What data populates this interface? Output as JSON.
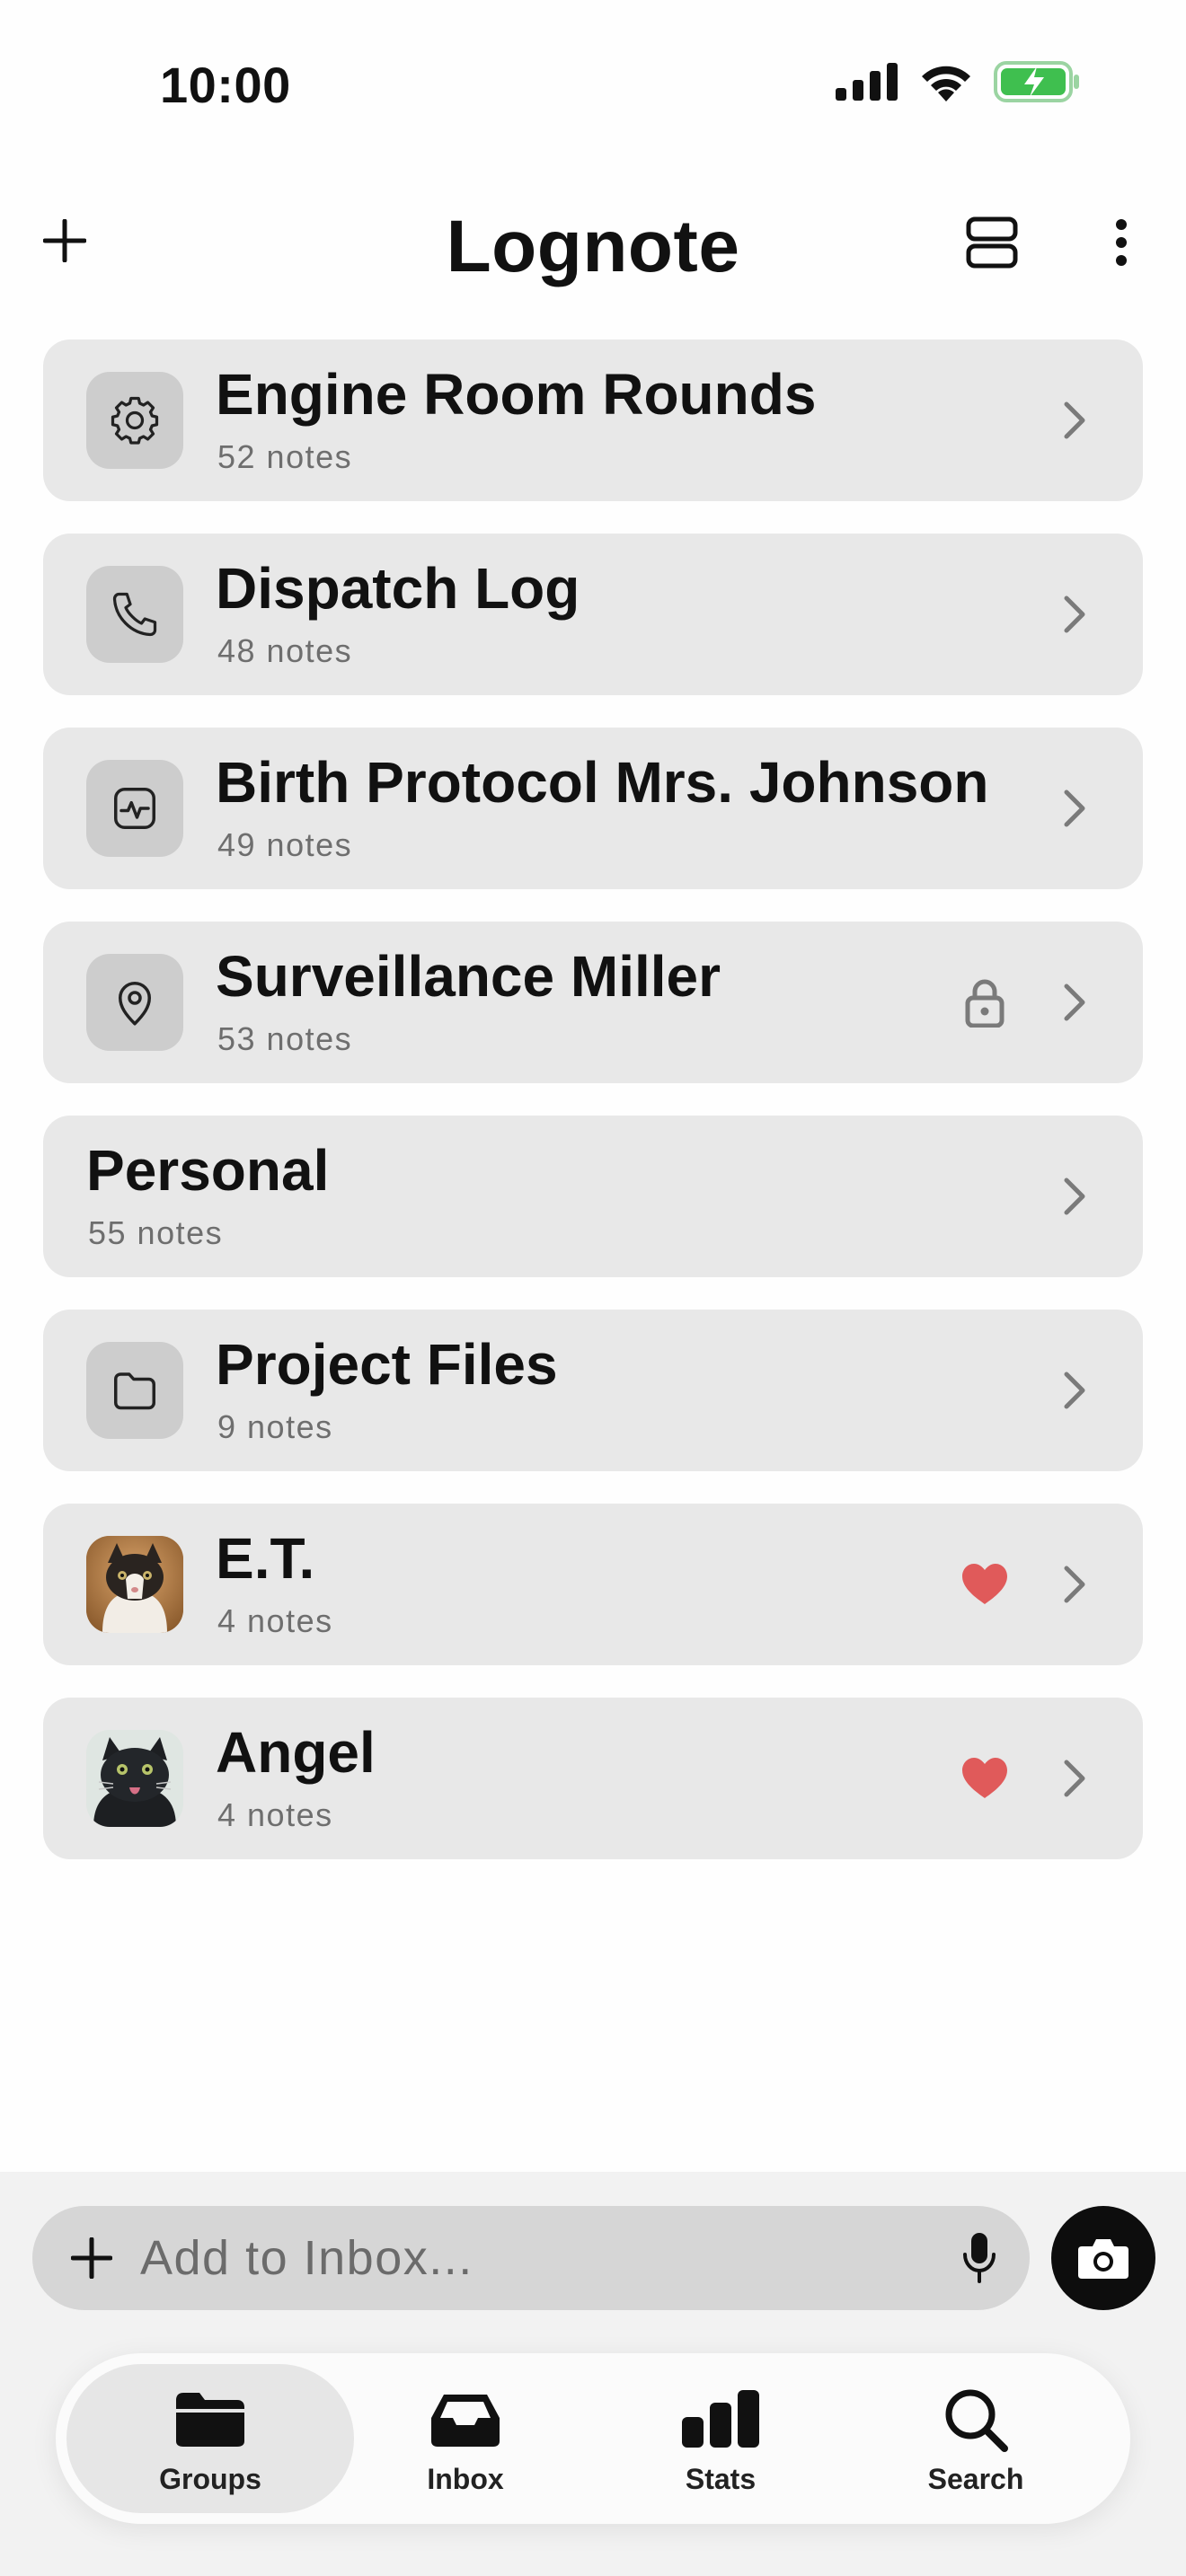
{
  "status_bar": {
    "time": "10:00"
  },
  "nav": {
    "title": "Lognote"
  },
  "groups": [
    {
      "title": "Engine Room Rounds",
      "count": "52 notes",
      "icon": "gear-icon"
    },
    {
      "title": "Dispatch Log",
      "count": "48 notes",
      "icon": "phone-icon"
    },
    {
      "title": "Birth Protocol Mrs. Johnson",
      "count": "49 notes",
      "icon": "heart-monitor-icon"
    },
    {
      "title": "Surveillance Miller",
      "count": "53 notes",
      "icon": "location-pin-icon",
      "badge": "lock-icon"
    },
    {
      "title": "Personal",
      "count": "55 notes"
    },
    {
      "title": "Project Files",
      "count": "9 notes",
      "icon": "folder-icon"
    },
    {
      "title": "E.T.",
      "count": "4 notes",
      "icon": "cat-photo-avatar",
      "badge": "heart-icon"
    },
    {
      "title": "Angel",
      "count": "4 notes",
      "icon": "cat-photo-avatar",
      "badge": "heart-icon"
    }
  ],
  "inbox": {
    "placeholder": "Add to Inbox..."
  },
  "tabs": [
    {
      "label": "Groups",
      "icon": "folder-icon",
      "active": true
    },
    {
      "label": "Inbox",
      "icon": "inbox-tray-icon"
    },
    {
      "label": "Stats",
      "icon": "bar-chart-icon"
    },
    {
      "label": "Search",
      "icon": "search-icon"
    }
  ],
  "colors": {
    "card_bg": "#e8e8e8",
    "icon_bg": "#cdcdcd",
    "heart": "#e05a5a",
    "battery": "#3fbf4f"
  }
}
